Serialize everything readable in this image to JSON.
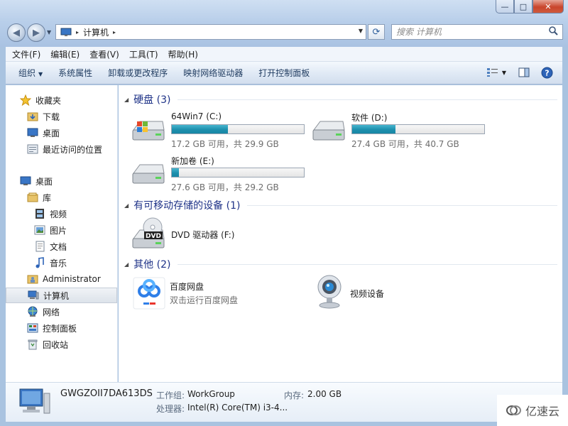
{
  "window": {
    "minimize_glyph": "—",
    "maximize_glyph": "□",
    "close_glyph": "✕"
  },
  "address": {
    "path_item": "计算机",
    "separator": "▸"
  },
  "search": {
    "placeholder": "搜索 计算机"
  },
  "menu": [
    "文件(F)",
    "编辑(E)",
    "查看(V)",
    "工具(T)",
    "帮助(H)"
  ],
  "commands": {
    "organize": "组织",
    "system_properties": "系统属性",
    "uninstall": "卸载或更改程序",
    "map_drive": "映射网络驱动器",
    "control_panel": "打开控制面板"
  },
  "nav": {
    "favorites": "收藏夹",
    "downloads": "下载",
    "desktop_fav": "桌面",
    "recent": "最近访问的位置",
    "desktop": "桌面",
    "libraries": "库",
    "videos": "视频",
    "pictures": "图片",
    "documents": "文档",
    "music": "音乐",
    "user": "Administrator",
    "computer": "计算机",
    "network": "网络",
    "control_panel": "控制面板",
    "recycle_bin": "回收站"
  },
  "groups": {
    "hard_disks": "硬盘 (3)",
    "removable": "有可移动存储的设备 (1)",
    "other": "其他 (2)"
  },
  "drives": [
    {
      "name": "64Win7  (C:)",
      "info": "17.2 GB 可用，共 29.9 GB",
      "used_fraction": 0.425
    },
    {
      "name": "软件 (D:)",
      "info": "27.4 GB 可用，共 40.7 GB",
      "used_fraction": 0.327
    },
    {
      "name": "新加卷 (E:)",
      "info": "27.6 GB 可用，共 29.2 GB",
      "used_fraction": 0.055
    }
  ],
  "dvd": {
    "name": "DVD 驱动器 (F:)",
    "badge": "DVD"
  },
  "other_items": {
    "baidu_name": "百度网盘",
    "baidu_sub": "双击运行百度网盘",
    "camera_name": "视频设备"
  },
  "details": {
    "pc_name": "GWGZOII7DA613DS",
    "workgroup_label": "工作组:",
    "workgroup_value": "WorkGroup",
    "memory_label": "内存:",
    "memory_value": "2.00 GB",
    "cpu_label": "处理器:",
    "cpu_value": "Intel(R) Core(TM) i3-4..."
  },
  "watermark": "亿速云",
  "colors": {
    "group_header": "#1e3287",
    "bar_fill": "#1d8fae",
    "selection": "#dde3ea"
  }
}
